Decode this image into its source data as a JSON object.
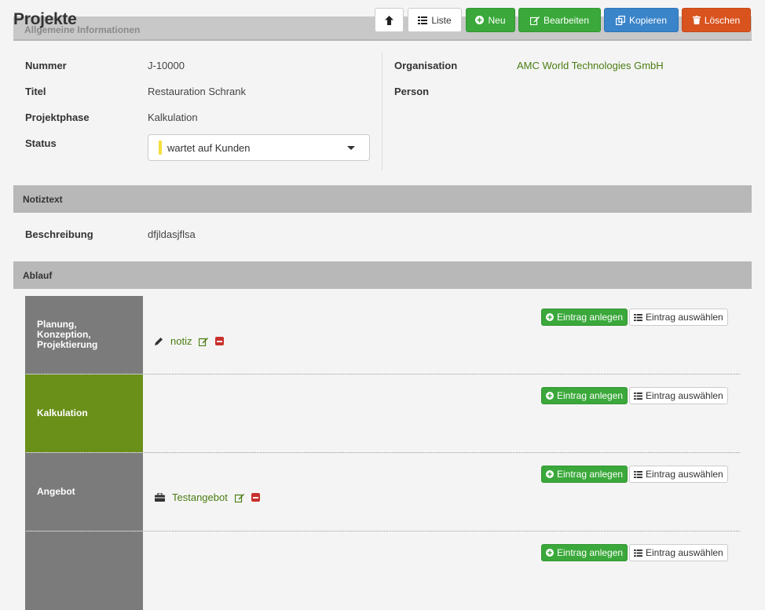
{
  "page": {
    "title": "Projekte"
  },
  "toolbar": {
    "up_icon": "arrow-up-icon",
    "list_label": "Liste",
    "new_label": "Neu",
    "edit_label": "Bearbeiten",
    "copy_label": "Kopieren",
    "delete_label": "Löschen"
  },
  "general": {
    "header": "Allgemeine Informationen",
    "fields": {
      "nummer": {
        "label": "Nummer",
        "value": "J-10000"
      },
      "titel": {
        "label": "Titel",
        "value": "Restauration Schrank"
      },
      "projektphase": {
        "label": "Projektphase",
        "value": "Kalkulation"
      },
      "status": {
        "label": "Status",
        "value": "wartet auf Kunden",
        "color": "#f5de3c"
      },
      "organisation": {
        "label": "Organisation",
        "value": "AMC World Technologies GmbH"
      },
      "person": {
        "label": "Person",
        "value": ""
      }
    }
  },
  "notiz": {
    "header": "Notiztext",
    "label": "Beschreibung",
    "value": "dfjldasjflsa"
  },
  "ablauf": {
    "header": "Ablauf",
    "add_label": "Eintrag anlegen",
    "select_label": "Eintrag auswählen",
    "phases": [
      {
        "label": "Planung, Konzeption, Projektierung",
        "entry": "notiz",
        "entry_icon": "pencil-icon"
      },
      {
        "label": "Kalkulation",
        "entry": "",
        "entry_icon": ""
      },
      {
        "label": "Angebot",
        "entry": "Testangebot",
        "entry_icon": "briefcase-icon"
      },
      {
        "label": "",
        "entry": "",
        "entry_icon": ""
      }
    ]
  },
  "colors": {
    "green_button": "#3aa83a",
    "blue_button": "#3a84c9",
    "red_button": "#d9531e",
    "active_phase": "#6a901a",
    "inactive_phase": "#7b7b7b",
    "link_green": "#4a7d12"
  }
}
